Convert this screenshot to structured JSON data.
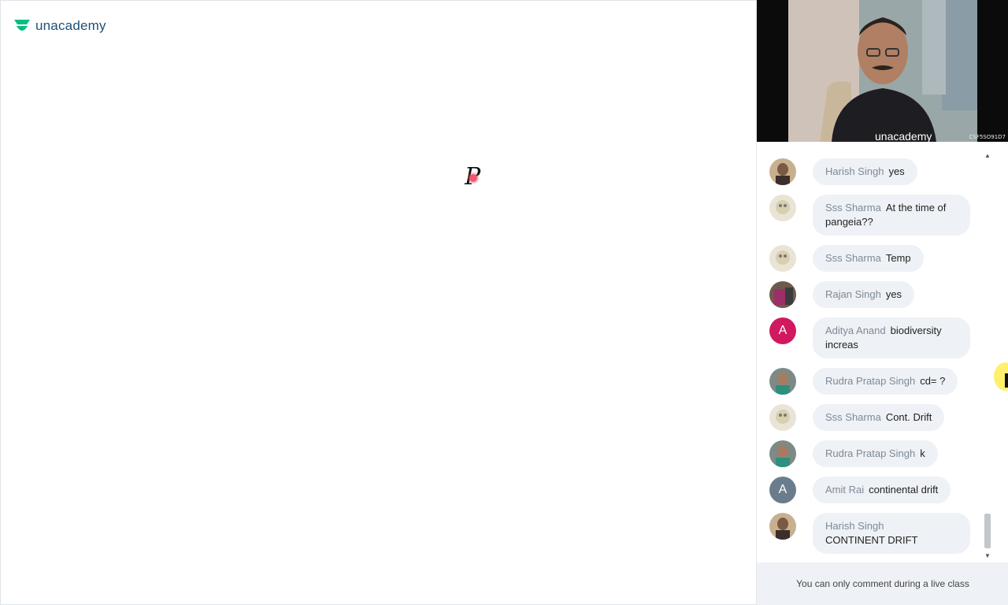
{
  "brand": {
    "name": "unacademy"
  },
  "board": {
    "letter": "P"
  },
  "video": {
    "stream_id": "CSF5SO91D7"
  },
  "chat": {
    "messages": [
      {
        "name": "Harish Singh",
        "text": "yes",
        "avatar": "photo"
      },
      {
        "name": "Sss Sharma",
        "text": "At the time of pangeia??",
        "avatar": "photo"
      },
      {
        "name": "Sss Sharma",
        "text": "Temp",
        "avatar": "photo"
      },
      {
        "name": "Rajan Singh",
        "text": "yes",
        "avatar": "photo"
      },
      {
        "name": "Aditya Anand",
        "text": "biodiversity increas",
        "avatar": "A"
      },
      {
        "name": "Rudra Pratap Singh",
        "text": "cd= ?",
        "avatar": "photo"
      },
      {
        "name": "Sss Sharma",
        "text": "Cont. Drift",
        "avatar": "photo"
      },
      {
        "name": "Rudra Pratap Singh",
        "text": "k",
        "avatar": "photo"
      },
      {
        "name": "Amit Rai",
        "text": "continental drift",
        "avatar": "A"
      },
      {
        "name": "Harish Singh",
        "text": "CONTINENT DRIFT",
        "avatar": "photo"
      }
    ],
    "footer": "You can only comment during a live class"
  },
  "colors": {
    "brand": "#08bd80",
    "bubble": "#eef1f5",
    "name_text": "#7e8a98",
    "avatar_aditya": "#d0195e",
    "avatar_amit": "#6b7c8c"
  }
}
